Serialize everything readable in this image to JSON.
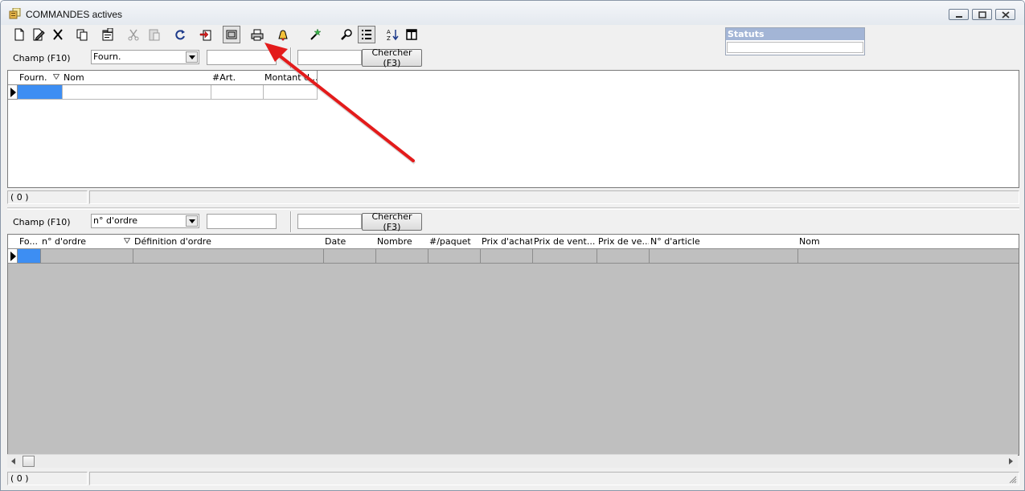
{
  "window": {
    "title": "COMMANDES actives"
  },
  "colors": {
    "arrow": "#e31b1b",
    "selected_cell": "#3d8ef3",
    "grid_grey": "#bfbfbf"
  },
  "toolbar": {
    "icons": [
      "new-document-icon",
      "edit-document-icon",
      "delete-icon",
      "copy-icon",
      "properties-icon",
      "disabled-cut-icon",
      "disabled-paste-icon",
      "refresh-icon",
      "import-icon",
      "preview-icon",
      "print-icon",
      "bell-icon",
      "wand-icon",
      "find-icon",
      "list-view-icon",
      "sort-icon",
      "columns-icon"
    ]
  },
  "statuts": {
    "title": "Statuts"
  },
  "top_search": {
    "field_label": "Champ (F10)",
    "field_value": "Fourn.",
    "search_button": "Chercher (F3)"
  },
  "top_grid": {
    "columns": [
      "Fourn.",
      "Nom",
      "#Art.",
      "Montant d..."
    ]
  },
  "top_status": {
    "count": "( 0 )"
  },
  "bottom_search": {
    "field_label": "Champ (F10)",
    "field_value": "n° d'ordre",
    "search_button": "Chercher (F3)"
  },
  "bottom_grid": {
    "columns": [
      "Fo...",
      "n° d'ordre",
      "Définition d'ordre",
      "Date",
      "Nombre",
      "#/paquet",
      "Prix d'achat",
      "Prix de vent...",
      "Prix de ve...",
      "N° d'article",
      "Nom"
    ]
  },
  "bottom_status": {
    "count": "( 0 )"
  }
}
